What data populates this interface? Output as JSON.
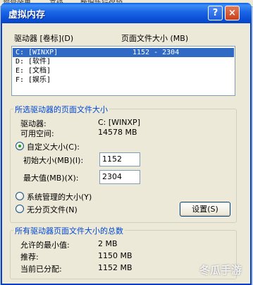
{
  "background_tabs": [
    "视觉效果",
    "高级",
    "数据执行保护"
  ],
  "dialog": {
    "title": "虚拟内存",
    "help_label": "?",
    "close_label": "×"
  },
  "drive_list": {
    "col_drive": "驱动器 [卷标](D)",
    "col_pagefile": "页面文件大小 (MB)",
    "rows": [
      {
        "drive": "C:",
        "label": "[WINXP]",
        "size": "1152 - 2304",
        "selected": true
      },
      {
        "drive": "D:",
        "label": "[软件]",
        "size": "",
        "selected": false
      },
      {
        "drive": "E:",
        "label": "[文档]",
        "size": "",
        "selected": false
      },
      {
        "drive": "F:",
        "label": "[娱乐]",
        "size": "",
        "selected": false
      }
    ]
  },
  "selected_drive": {
    "group_title": "所选驱动器的页面文件大小",
    "drive_label": "驱动器:",
    "drive_value": "C:  [WINXP]",
    "space_label": "可用空间:",
    "space_value": "14578 MB",
    "custom_size_label": "自定义大小(C):",
    "initial_label": "初始大小(MB)(I):",
    "initial_value": "1152",
    "max_label": "最大值(MB)(X):",
    "max_value": "2304",
    "system_managed_label": "系统管理的大小(Y)",
    "no_pagefile_label": "无分页文件(N)",
    "set_button": "设置(S)"
  },
  "totals": {
    "group_title": "所有驱动器页面文件大小的总数",
    "min_label": "允许的最小值:",
    "min_value": "2 MB",
    "recommended_label": "推荐:",
    "recommended_value": "1150 MB",
    "current_label": "当前已分配:",
    "current_value": "1152 MB"
  },
  "watermark": "冬瓜手游"
}
